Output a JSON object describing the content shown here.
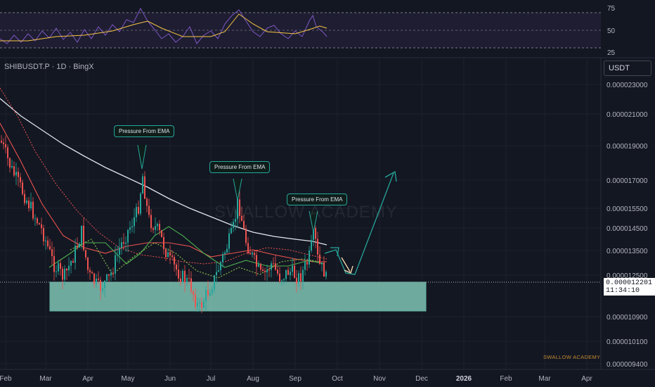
{
  "header": {
    "symbol": "SHIBUSDT.P · 1D · BingX",
    "currency": "USDT"
  },
  "rsi_axis": [
    "75",
    "50",
    "25"
  ],
  "price_axis": [
    "0.000023000",
    "0.000021000",
    "0.000019000",
    "0.000017000",
    "0.000015500",
    "0.000014500",
    "0.000013500",
    "0.000012500",
    "0.000010900",
    "0.000010100",
    "0.000009400"
  ],
  "last_price": {
    "value": "0.000012201",
    "countdown": "11:34:10"
  },
  "time_axis": [
    "Feb",
    "Mar",
    "Apr",
    "May",
    "Jun",
    "Jul",
    "Aug",
    "Sep",
    "Oct",
    "Nov",
    "Dec",
    "2026",
    "Feb",
    "Mar",
    "Apr"
  ],
  "annotations": [
    "Pressure From EMA",
    "Pressure From EMA",
    "Pressure From EMA"
  ],
  "watermark": "SWALLOW ACADEMY",
  "brand": "SWALLOW ACADEMY",
  "colors": {
    "up": "#26a69a",
    "down": "#ef5350",
    "zone": "#7fc4b4",
    "ema_white": "#e0e3eb",
    "ema_red": "#ef5350",
    "ema_green": "#4caf50",
    "rsi_line": "#7e57c2",
    "rsi_ma": "#f7c543",
    "arrow_up": "#26a69a",
    "arrow_down": "#ffe0b2"
  }
}
